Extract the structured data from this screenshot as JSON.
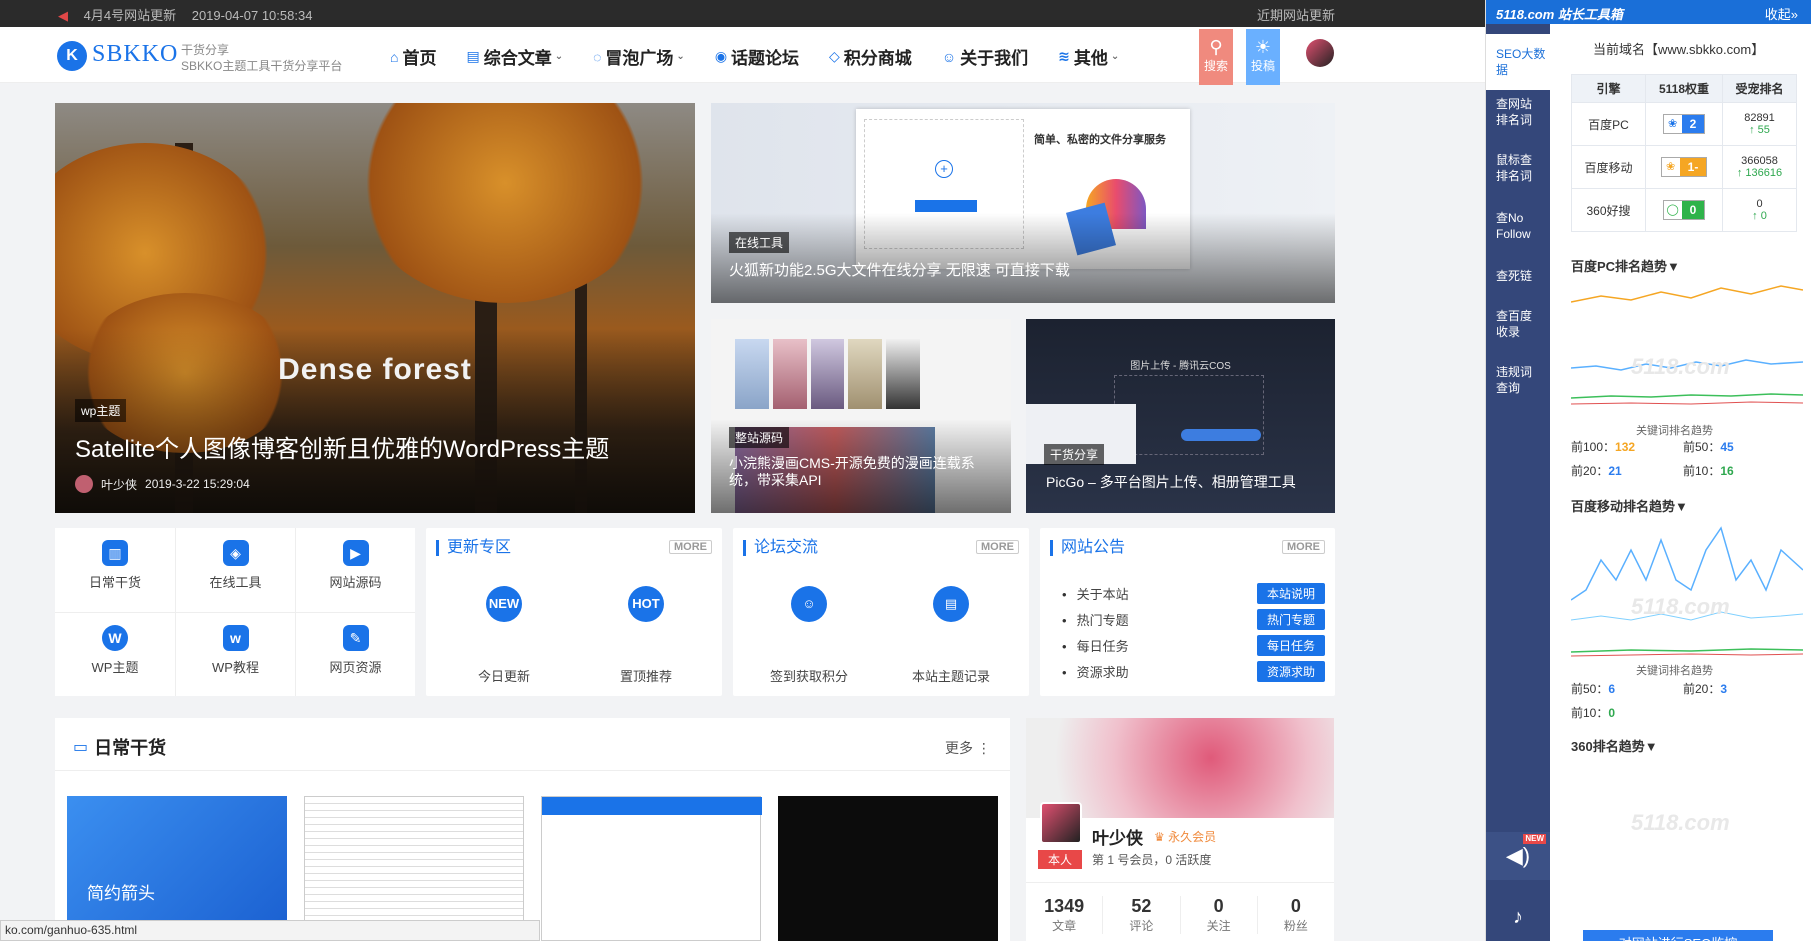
{
  "topbar": {
    "news_title": "4月4号网站更新",
    "news_time": "2019-04-07 10:58:34",
    "recent_update": "近期网站更新"
  },
  "header": {
    "logo_letter": "K",
    "logo_text": "SBKKO",
    "slogan_line1": "干货分享",
    "slogan_line2": "SBKKO主题工具干货分享平台",
    "nav": [
      {
        "label": "首页",
        "icon": "home-icon",
        "dropdown": false
      },
      {
        "label": "综合文章",
        "icon": "article-icon",
        "dropdown": true
      },
      {
        "label": "冒泡广场",
        "icon": "bubble-icon",
        "dropdown": true
      },
      {
        "label": "话题论坛",
        "icon": "location-icon",
        "dropdown": false
      },
      {
        "label": "积分商城",
        "icon": "diamond-icon",
        "dropdown": false
      },
      {
        "label": "关于我们",
        "icon": "user-icon",
        "dropdown": false
      },
      {
        "label": "其他",
        "icon": "layers-icon",
        "dropdown": true
      }
    ],
    "search_label": "搜索",
    "submit_label": "投稿",
    "search_color": "#f08080",
    "submit_color": "#6ab0ff"
  },
  "hero": {
    "big_text": "Dense forest",
    "tag": "wp主题",
    "title": "Satelite个人图像博客创新且优雅的WordPress主题",
    "author": "叶少侠",
    "date": "2019-3-22 15:29:04"
  },
  "cards": [
    {
      "tag": "在线工具",
      "title": "火狐新功能2.5G大文件在线分享 无限速 可直接下载",
      "preview_heading": "简单、私密的文件分享服务"
    },
    {
      "tag": "整站源码",
      "title": "小浣熊漫画CMS-开源免费的漫画连载系统，带采集API"
    },
    {
      "tag": "干货分享",
      "title": "PicGo – 多平台图片上传、相册管理工具",
      "preview_heading": "图片上传 - 腾讯云COS"
    }
  ],
  "quick_links": [
    {
      "label": "日常干货",
      "icon": "book-icon"
    },
    {
      "label": "在线工具",
      "icon": "compass-icon"
    },
    {
      "label": "网站源码",
      "icon": "code-icon"
    },
    {
      "label": "WP主题",
      "icon": "wordpress-icon"
    },
    {
      "label": "WP教程",
      "icon": "folder-icon"
    },
    {
      "label": "网页资源",
      "icon": "edit-icon"
    }
  ],
  "update_panel": {
    "title": "更新专区",
    "more": "MORE",
    "items": [
      {
        "label": "今日更新",
        "icon": "NEW"
      },
      {
        "label": "置顶推荐",
        "icon": "HOT"
      }
    ]
  },
  "forum_panel": {
    "title": "论坛交流",
    "more": "MORE",
    "items": [
      {
        "label": "签到获取积分",
        "icon": "smile-icon"
      },
      {
        "label": "本站主题记录",
        "icon": "chat-icon"
      }
    ]
  },
  "notice_panel": {
    "title": "网站公告",
    "more": "MORE",
    "items": [
      {
        "label": "关于本站",
        "button": "本站说明"
      },
      {
        "label": "热门专题",
        "button": "热门专题"
      },
      {
        "label": "每日任务",
        "button": "每日任务"
      },
      {
        "label": "资源求助",
        "button": "资源求助"
      }
    ]
  },
  "daily": {
    "title": "日常干货",
    "more": "更多",
    "thumb1_text": "简约箭头"
  },
  "profile": {
    "name": "叶少侠",
    "vip": "永久会员",
    "role": "本人",
    "desc": "第 1 号会员，0 活跃度",
    "stats": [
      {
        "value": "1349",
        "label": "文章"
      },
      {
        "value": "52",
        "label": "评论"
      },
      {
        "value": "0",
        "label": "关注"
      },
      {
        "value": "0",
        "label": "粉丝"
      }
    ]
  },
  "status_bar": {
    "url": "ko.com/ganhuo-635.html"
  },
  "seo": {
    "brand": "5118.com 站长工具箱",
    "collapse": "收起»",
    "side_nav": [
      "SEO大数据",
      "查网站排名词",
      "鼠标查排名词",
      "查No Follow",
      "查死链",
      "查百度收录",
      "违规词查询"
    ],
    "domain": "当前域名【www.sbkko.com】",
    "table_headers": [
      "引擎",
      "5118权重",
      "受宠排名"
    ],
    "rows": [
      {
        "engine": "百度PC",
        "weight": "2",
        "weight_color": "#2b7cee",
        "rank": "82891",
        "delta": "↑ 55"
      },
      {
        "engine": "百度移动",
        "weight": "1-",
        "weight_color": "#f5a623",
        "rank": "366058",
        "delta": "↑ 136616"
      },
      {
        "engine": "360好搜",
        "weight": "0",
        "weight_color": "#2fb34a",
        "rank": "0",
        "delta": "↑ 0"
      }
    ],
    "pc_trend_title": "百度PC排名趋势▼",
    "kw_dist_label": "关键词排名趋势",
    "pc_kw": {
      "top100": "132",
      "top50": "45",
      "top20": "21",
      "top10": "16"
    },
    "mobile_trend_title": "百度移动排名趋势▼",
    "mobile_kw": {
      "top50": "6",
      "top20": "3",
      "top10": "0"
    },
    "s360_title": "360排名趋势▼",
    "kw_labels": {
      "top100": "前100：",
      "top50": "前50：",
      "top20": "前20：",
      "top10": "前10："
    },
    "watermark": "5118.com",
    "new_badge": "NEW",
    "monitor_button": "对网站进行SEO监控"
  }
}
